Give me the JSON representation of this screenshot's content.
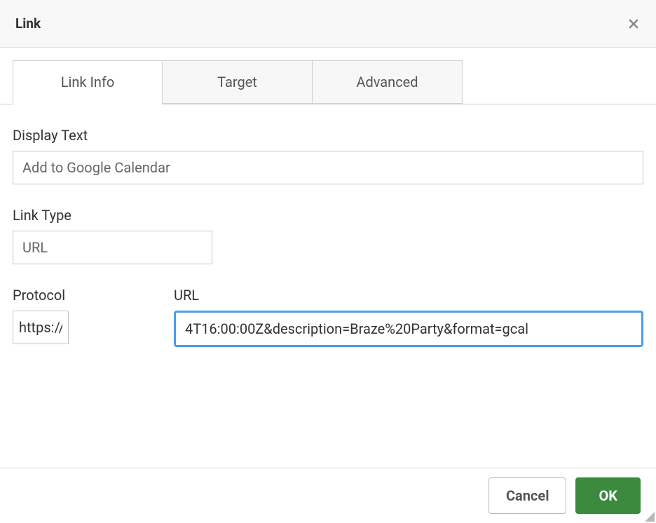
{
  "dialog": {
    "title": "Link"
  },
  "tabs": {
    "link_info": "Link Info",
    "target": "Target",
    "advanced": "Advanced"
  },
  "fields": {
    "display_text": {
      "label": "Display Text",
      "value": "Add to Google Calendar"
    },
    "link_type": {
      "label": "Link Type",
      "value": "URL"
    },
    "protocol": {
      "label": "Protocol",
      "value": "https://"
    },
    "url": {
      "label": "URL",
      "value": "4T16:00:00Z&description=Braze%20Party&format=gcal"
    }
  },
  "buttons": {
    "cancel": "Cancel",
    "ok": "OK"
  }
}
